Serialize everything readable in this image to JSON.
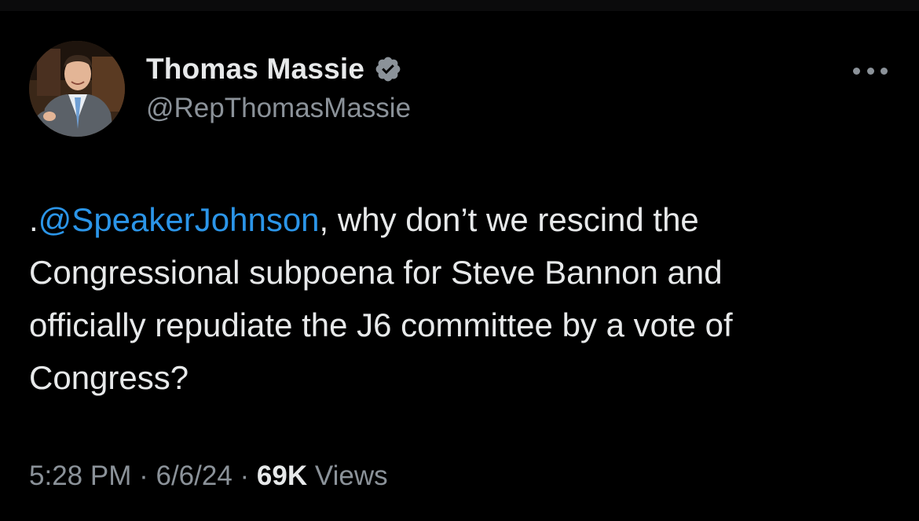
{
  "author": {
    "display_name": "Thomas Massie",
    "handle": "@RepThomasMassie",
    "verified_badge_color": "#8b9299"
  },
  "tweet": {
    "text_prefix": ".",
    "mention": "@SpeakerJohnson",
    "line1_rest": ", why don’t we rescind the",
    "line2": "Congressional subpoena for Steve Bannon and",
    "line3": "officially repudiate the J6 committee by a vote of",
    "line4": "Congress?"
  },
  "meta": {
    "time": "5:28 PM",
    "separator": "·",
    "date": "6/6/24",
    "views_count": "69K",
    "views_label": "Views"
  },
  "icons": {
    "more": "more-horizontal-icon",
    "verified": "verified-badge-icon"
  },
  "colors": {
    "background": "#000000",
    "text": "#e7e9ea",
    "secondary": "#8b9299",
    "link": "#2b95e8"
  }
}
